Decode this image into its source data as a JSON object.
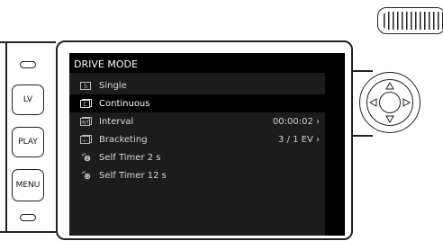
{
  "side_buttons": {
    "lv": "LV",
    "play": "PLAY",
    "menu": "MENU"
  },
  "menu": {
    "title": "DRIVE MODE",
    "items": [
      {
        "label": "Single",
        "value": "",
        "icon": "single-frame-icon",
        "selected": false
      },
      {
        "label": "Continuous",
        "value": "",
        "icon": "continuous-icon",
        "selected": true
      },
      {
        "label": "Interval",
        "value": "00:00:02 ›",
        "icon": "interval-icon",
        "selected": false
      },
      {
        "label": "Bracketing",
        "value": "3 / 1 EV ›",
        "icon": "bracketing-icon",
        "selected": false
      },
      {
        "label": "Self Timer 2 s",
        "value": "",
        "icon": "self-timer-icon",
        "selected": false
      },
      {
        "label": "Self Timer 12 s",
        "value": "",
        "icon": "self-timer-icon",
        "selected": false
      }
    ]
  },
  "colors": {
    "screen_bg": "#1c1c1c",
    "header_bg": "#000000",
    "selected_bg": "#000000",
    "text": "#d8d8d8"
  }
}
